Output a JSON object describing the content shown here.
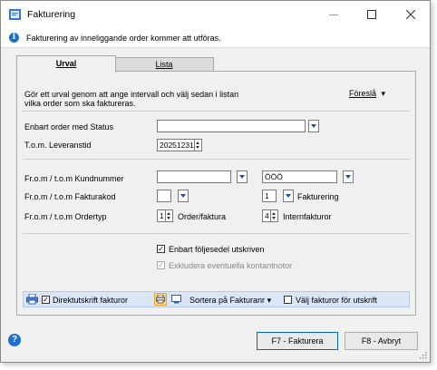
{
  "window": {
    "title": "Fakturering",
    "info_message": "Fakturering av inneliggande order kommer att utföras."
  },
  "tabs": [
    {
      "label": "Urval",
      "active": true
    },
    {
      "label": "Lista",
      "active": false
    }
  ],
  "urval": {
    "description": "Gör ett urval genom att ange intervall och välj sedan i listan vilka order som ska faktureras.",
    "foresla_label": "Föreslå",
    "status_label": "Enbart order med Status",
    "status_value": "",
    "leveranstid_label": "T.o.m. Leveranstid",
    "leveranstid_value": "20251231",
    "kundnummer_label": "Fr.o.m / t.o.m Kundnummer",
    "kundnummer_from": "",
    "kundnummer_to": "ÖÖÖ",
    "fakturakod_label": "Fr.o.m / t.o.m Fakturakod",
    "fakturakod_from": "",
    "fakturakod_to": "1",
    "fakturakod_to_text": "Fakturering",
    "ordertyp_label": "Fr.o.m / t.o.m Ordertyp",
    "ordertyp_from": "1",
    "ordertyp_from_text": "Order/faktura",
    "ordertyp_to": "4",
    "ordertyp_to_text": "Internfakturor",
    "foljesedel_label": "Enbart följesedel utskriven",
    "foljesedel_checked": true,
    "kontantnotor_label": "Exkludera eventuella kontantnotor",
    "kontantnotor_checked": true
  },
  "toolstrip": {
    "direktutskrift_label": "Direktutskrift fakturor",
    "direktutskrift_checked": true,
    "sort_label": "Sortera på Fakturanr",
    "valj_label": "Välj fakturor för utskrift",
    "valj_checked": false
  },
  "buttons": {
    "ok": "F7 - Fakturera",
    "cancel": "F8 - Avbryt"
  }
}
